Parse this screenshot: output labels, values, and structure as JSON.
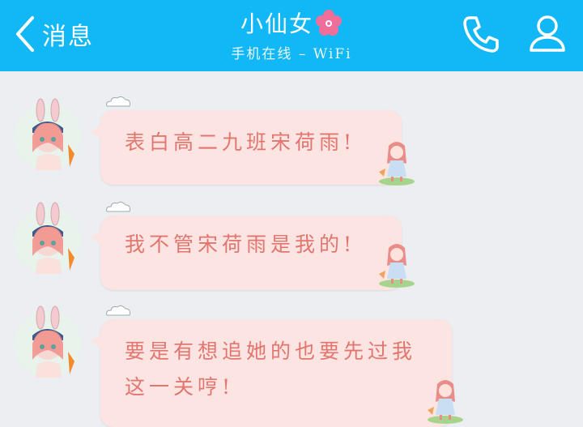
{
  "header": {
    "back_label": "消息",
    "contact_name": "小仙女",
    "status": "手机在线 – WiFi",
    "background": "#12b7f5"
  },
  "messages": [
    {
      "sender": "other",
      "text": "表白高二九班宋荷雨!"
    },
    {
      "sender": "other",
      "text": "我不管宋荷雨是我的!"
    },
    {
      "sender": "other",
      "text_line1": "要是有想追她的也要先过我",
      "text_line2": "这一关哼!"
    }
  ],
  "icons": {
    "back": "chevron-left-icon",
    "title_decoration": "flower-icon",
    "call": "phone-icon",
    "profile": "person-icon",
    "avatar": "bunny-girl-avatar",
    "bubble_decoration": "cloud-icon",
    "bubble_sticker": "chibi-girl-sticker"
  },
  "colors": {
    "bubble_background": "#fbe4e1",
    "bubble_text": "#e2766f",
    "chat_background": "#edeef2"
  }
}
